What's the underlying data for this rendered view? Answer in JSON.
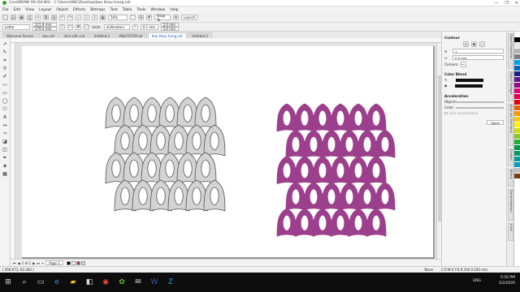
{
  "window": {
    "title": "CorelDRAW X8 (64-Bit) - C:\\Users\\HBC\\Desktop\\bao khau trang.cdr",
    "controls": [
      "—",
      "❐",
      "✕"
    ]
  },
  "menu": [
    "File",
    "Edit",
    "View",
    "Layout",
    "Object",
    "Effects",
    "Bitmaps",
    "Text",
    "Table",
    "Tools",
    "Window",
    "Help"
  ],
  "toolbar1": {
    "zoom": "56%",
    "snap_to": "Snap To",
    "launch": "Launch"
  },
  "toolbar2": {
    "paper": "Letter",
    "width": "215.9 mm",
    "height": "279.4 mm",
    "units_label": "Units:",
    "units": "millimeters",
    "nudge": "0.1 mm",
    "dup_x": "5.0 mm",
    "dup_y": "5.0 mm"
  },
  "doc_tabs": [
    {
      "label": "Welcome Screen",
      "active": false
    },
    {
      "label": "bao.cdr",
      "active": false
    },
    {
      "label": "dinh kiên.cdr",
      "active": false
    },
    {
      "label": "Untitled-2",
      "active": false
    },
    {
      "label": "VIBUTSTOP.cdr",
      "active": false
    },
    {
      "label": "bao khau trang.cdr",
      "active": true
    },
    {
      "label": "Untitled-3",
      "active": false
    }
  ],
  "tools": [
    "pick-icon",
    "shape-icon",
    "crop-icon",
    "zoom-icon",
    "freehand-icon",
    "artistic-media-icon",
    "rectangle-icon",
    "ellipse-icon",
    "polygon-icon",
    "text-icon",
    "parallel-dimension-icon",
    "connector-icon",
    "drop-shadow-icon",
    "transparency-icon",
    "eyedropper-icon",
    "interactive-fill-icon",
    "smart-fill-icon"
  ],
  "page_nav": {
    "counter": "1 of 1",
    "page_tab": "Page 1"
  },
  "status": {
    "coords": "( 456.673, 82.383 )",
    "fill_label": "None",
    "outline_label": "C:0 M:0 Y:0 K:100  0.200 mm"
  },
  "docker": {
    "title": "Contour",
    "steps": "1",
    "offset": "0.5 mm",
    "corners_label": "Corners:",
    "color_blend_title": "Color Blend",
    "acceleration_title": "Acceleration",
    "object_label": "Object:",
    "color_label": "Color:",
    "link_label": "Link acceleration",
    "apply_label": "Apply",
    "vertical_tabs": [
      "Object Properties",
      "Object Manager",
      "Align and Distribute",
      "Contour",
      "Effects",
      "Transformations",
      "Hints"
    ]
  },
  "palette": [
    "#ffffff",
    "#000000",
    "#e5e5e5",
    "#b3b3b3",
    "#808080",
    "#00a0e9",
    "#0068b7",
    "#1d2088",
    "#601986",
    "#920783",
    "#e4007f",
    "#e5004f",
    "#e60012",
    "#eb6100",
    "#f39800",
    "#fcc800",
    "#fff100",
    "#cfdb00",
    "#8fc31f",
    "#22ac38",
    "#009944",
    "#009b6b",
    "#009e96",
    "#00a0c1",
    "#c0c0c0",
    "#7b3f00"
  ],
  "taskbar": {
    "icons": [
      "windows-start-icon",
      "search-icon",
      "task-view-icon",
      "edge-icon",
      "file-explorer-icon",
      "store-icon",
      "chrome-icon",
      "coreldraw-icon",
      "mail-icon",
      "word-icon",
      "zalo-icon"
    ],
    "time": "5:50 PM",
    "date": "3/2/2020",
    "ime": "ENG"
  },
  "artwork": {
    "left_fill": "#d3d3d3",
    "left_stroke": "#555555",
    "right_fill": "#9c3f8c",
    "rows": 4,
    "cols": 6
  }
}
